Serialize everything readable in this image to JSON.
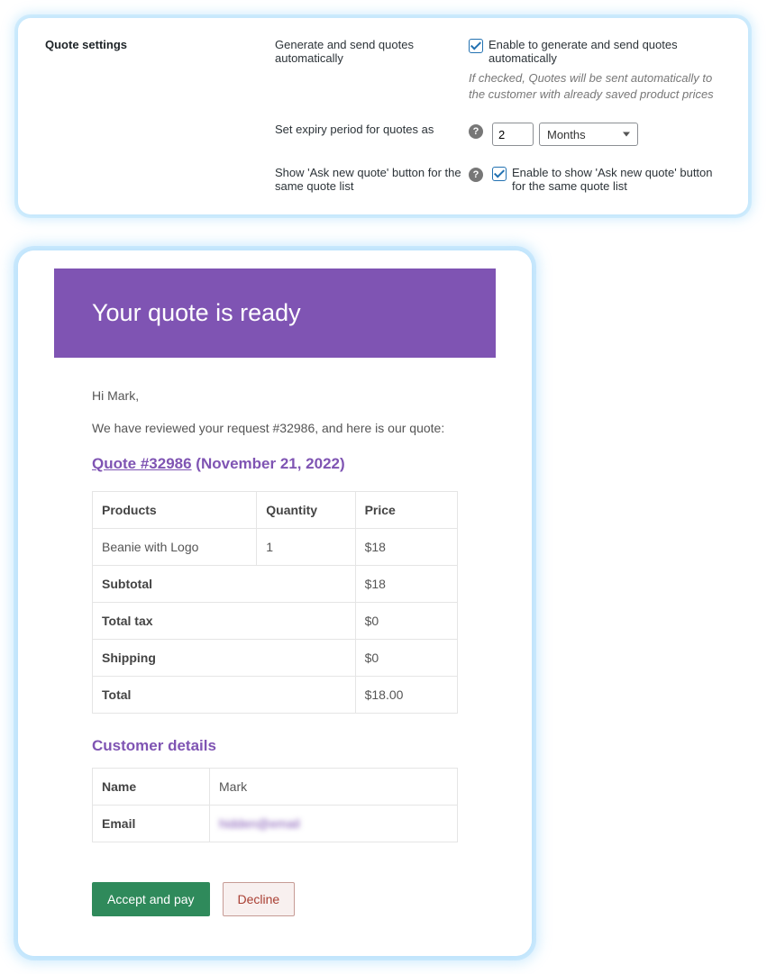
{
  "settings": {
    "section_title": "Quote settings",
    "rows": {
      "auto": {
        "label": "Generate and send quotes automatically",
        "checkbox_label": "Enable to generate and send quotes automatically",
        "hint": "If checked, Quotes will be sent automatically to the customer with already saved product prices"
      },
      "expiry": {
        "label": "Set expiry period for quotes as",
        "value": "2",
        "unit": "Months"
      },
      "asknew": {
        "label": "Show 'Ask new quote' button for the same quote list",
        "checkbox_label": "Enable to show 'Ask new quote' button for the same quote list"
      }
    }
  },
  "email": {
    "header": "Your quote is ready",
    "greeting": "Hi Mark,",
    "intro": "We have reviewed your request #32986, and here is our quote:",
    "quote_link": "Quote #32986",
    "quote_date": "(November 21, 2022)",
    "table": {
      "headers": {
        "product": "Products",
        "qty": "Quantity",
        "price": "Price"
      },
      "items": [
        {
          "product": "Beanie with Logo",
          "qty": "1",
          "price": "$18"
        }
      ],
      "totals": [
        {
          "label": "Subtotal",
          "value": "$18"
        },
        {
          "label": "Total tax",
          "value": "$0"
        },
        {
          "label": "Shipping",
          "value": "$0"
        },
        {
          "label": "Total",
          "value": "$18.00"
        }
      ]
    },
    "customer": {
      "heading": "Customer details",
      "name_label": "Name",
      "name_value": "Mark",
      "email_label": "Email",
      "email_value": "hidden@email"
    },
    "buttons": {
      "accept": "Accept and pay",
      "decline": "Decline"
    }
  }
}
